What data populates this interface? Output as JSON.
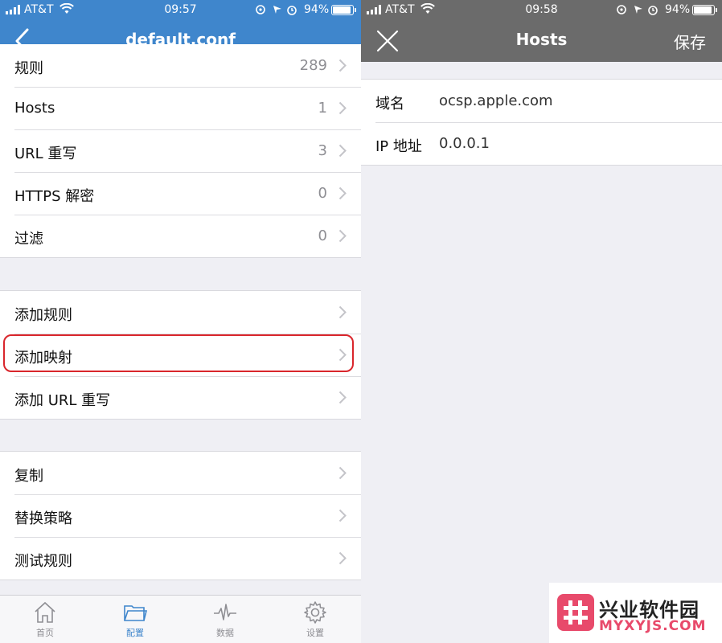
{
  "left_screen": {
    "status": {
      "carrier": "AT&T",
      "time": "09:57",
      "battery": "94%"
    },
    "title": "default.conf",
    "group1": [
      {
        "label": "规则",
        "count": "289"
      },
      {
        "label": "Hosts",
        "count": "1"
      },
      {
        "label": "URL 重写",
        "count": "3"
      },
      {
        "label": "HTTPS 解密",
        "count": "0"
      },
      {
        "label": "过滤",
        "count": "0"
      }
    ],
    "group2": [
      {
        "label": "添加规则"
      },
      {
        "label": "添加映射"
      },
      {
        "label": "添加 URL 重写"
      }
    ],
    "group3": [
      {
        "label": "复制"
      },
      {
        "label": "替换策略"
      },
      {
        "label": "测试规则"
      }
    ],
    "tabs": [
      {
        "label": "首页",
        "icon": "home-icon"
      },
      {
        "label": "配置",
        "icon": "folder-icon",
        "active": true
      },
      {
        "label": "数据",
        "icon": "pulse-icon"
      },
      {
        "label": "设置",
        "icon": "gear-icon"
      }
    ],
    "accent": "#3f86cc"
  },
  "right_screen": {
    "status": {
      "carrier": "AT&T",
      "time": "09:58",
      "battery": "94%"
    },
    "title": "Hosts",
    "save_label": "保存",
    "fields": [
      {
        "label": "域名",
        "value": "ocsp.apple.com"
      },
      {
        "label": "IP 地址",
        "value": "0.0.0.1"
      }
    ],
    "header_color": "#6b6b6b"
  },
  "watermark": {
    "name": "兴业软件园",
    "domain": "MYXYJS.COM",
    "color": "#e84a6b"
  }
}
